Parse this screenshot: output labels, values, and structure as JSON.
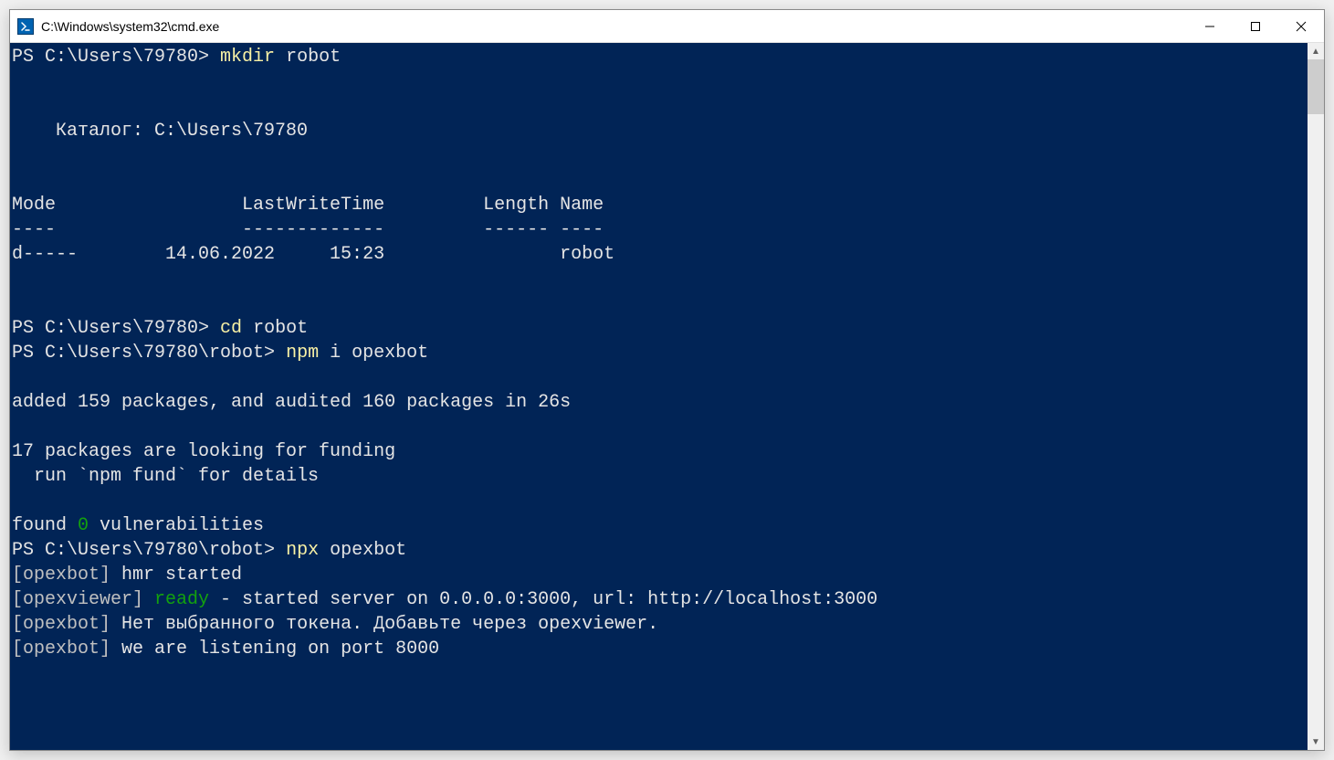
{
  "window": {
    "title": "C:\\Windows\\system32\\cmd.exe"
  },
  "terminal": {
    "line1": {
      "prompt": "PS C:\\Users\\79780> ",
      "cmd": "mkdir",
      "args": " robot"
    },
    "catalog_line": "    Каталог: C:\\Users\\79780",
    "header1": "Mode                 LastWriteTime         Length Name",
    "header2": "----                 -------------         ------ ----",
    "row1": "d-----        14.06.2022     15:23                robot",
    "line2": {
      "prompt": "PS C:\\Users\\79780> ",
      "cmd": "cd",
      "args": " robot"
    },
    "line3": {
      "prompt": "PS C:\\Users\\79780\\robot> ",
      "cmd": "npm",
      "args": " i opexbot"
    },
    "added": "added 159 packages, and audited 160 packages in 26s",
    "fund1": "17 packages are looking for funding",
    "fund2": "  run `npm fund` for details",
    "found_pre": "found ",
    "found_zero": "0",
    "found_suf": " vulnerabilities",
    "line4": {
      "prompt": "PS C:\\Users\\79780\\robot> ",
      "cmd": "npx",
      "args": " opexbot"
    },
    "hmr_pre": "[opexbot]",
    "hmr_txt": " hmr started",
    "ready_pre": "[opexviewer]",
    "ready_word": " ready",
    "ready_txt": " - started server on 0.0.0.0:3000, url: http://localhost:3000",
    "token_pre": "[opexbot]",
    "token_txt": " Нет выбранного токена. Добавьте через opexviewer.",
    "listen_pre": "[opexbot]",
    "listen_txt": " we are listening on port 8000"
  }
}
